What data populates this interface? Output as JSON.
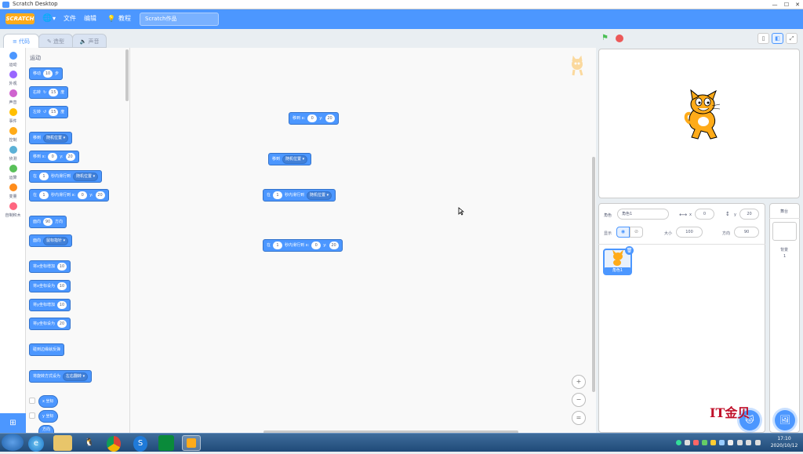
{
  "window": {
    "title": "Scratch Desktop",
    "controls": [
      "—",
      "☐",
      "✕"
    ]
  },
  "menubar": {
    "logo": "SCRATCH",
    "globe": "🌐",
    "file": "文件",
    "edit": "编辑",
    "tutorials": "教程",
    "project_name": "Scratch作品"
  },
  "tabs": [
    "代码",
    "造型",
    "声音"
  ],
  "categories": [
    {
      "label": "运动",
      "color": "#4c97ff"
    },
    {
      "label": "外观",
      "color": "#9966ff"
    },
    {
      "label": "声音",
      "color": "#cf63cf"
    },
    {
      "label": "事件",
      "color": "#ffbf00"
    },
    {
      "label": "控制",
      "color": "#ffab19"
    },
    {
      "label": "侦测",
      "color": "#5cb1d6"
    },
    {
      "label": "运算",
      "color": "#59c059"
    },
    {
      "label": "变量",
      "color": "#ff8c1a"
    },
    {
      "label": "自制积木",
      "color": "#ff6680"
    }
  ],
  "palette": {
    "heading": "运动",
    "move": {
      "a": "移动",
      "n": "10",
      "b": "步"
    },
    "turn_right": {
      "a": "右转",
      "n": "15",
      "b": "度"
    },
    "turn_left": {
      "a": "左转",
      "n": "15",
      "b": "度"
    },
    "goto": {
      "a": "移到",
      "dd": "随机位置 ▾"
    },
    "goto_xy": {
      "a": "移到 x:",
      "x": "0",
      "b": "y:",
      "y": "20"
    },
    "glide": {
      "a": "在",
      "n": "1",
      "b": "秒内滑行到",
      "dd": "随机位置 ▾"
    },
    "glide_xy": {
      "a": "在",
      "n": "1",
      "b": "秒内滑行到 x:",
      "x": "0",
      "c": "y:",
      "y": "20"
    },
    "point_dir": {
      "a": "面向",
      "n": "90",
      "b": "方向"
    },
    "point_to": {
      "a": "面向",
      "dd": "鼠标指针 ▾"
    },
    "change_x": {
      "a": "将x坐标增加",
      "n": "10"
    },
    "set_x": {
      "a": "将x坐标设为",
      "n": "10"
    },
    "change_y": {
      "a": "将y坐标增加",
      "n": "10"
    },
    "set_y": {
      "a": "将y坐标设为",
      "n": "20"
    },
    "bounce": "碰到边缘就反弹",
    "rotation": {
      "a": "将旋转方式设为",
      "dd": "左右翻转 ▾"
    },
    "rep_x": "x 坐标",
    "rep_y": "y 坐标",
    "rep_dir": "方向"
  },
  "workspace": {
    "b1": {
      "a": "移到 x:",
      "x": "0",
      "b": "y:",
      "y": "20"
    },
    "b2": {
      "a": "移到",
      "dd": "随机位置 ▾"
    },
    "b3": {
      "a": "在",
      "n": "1",
      "b": "秒内滑行到",
      "dd": "随机位置 ▾"
    },
    "b4": {
      "a": "在",
      "n": "1",
      "b": "秒内滑行到 x:",
      "x": "0",
      "c": "y:",
      "y": "20"
    },
    "zoom_in": "+",
    "zoom_out": "−",
    "zoom_reset": "="
  },
  "stage_controls": {
    "flag": "⚑"
  },
  "sprite_panel": {
    "sprite_label": "角色",
    "sprite_name": "角色1",
    "x_label": "x",
    "x": "0",
    "y_label": "y",
    "y": "20",
    "show_label": "显示",
    "size_label": "大小",
    "size": "100",
    "dir_label": "方向",
    "dir": "90",
    "thumb_name": "角色1"
  },
  "stage_panel": {
    "label": "舞台",
    "backdrop_label": "背景",
    "backdrop_count": "1"
  },
  "watermark": "IT金贝",
  "taskbar": {
    "time": "17:10",
    "date": "2020/10/12"
  },
  "colors": {
    "motion": "#4c97ff",
    "menubar": "#4c97ff",
    "flag": "#4cbf56",
    "stop": "#ec5959"
  }
}
